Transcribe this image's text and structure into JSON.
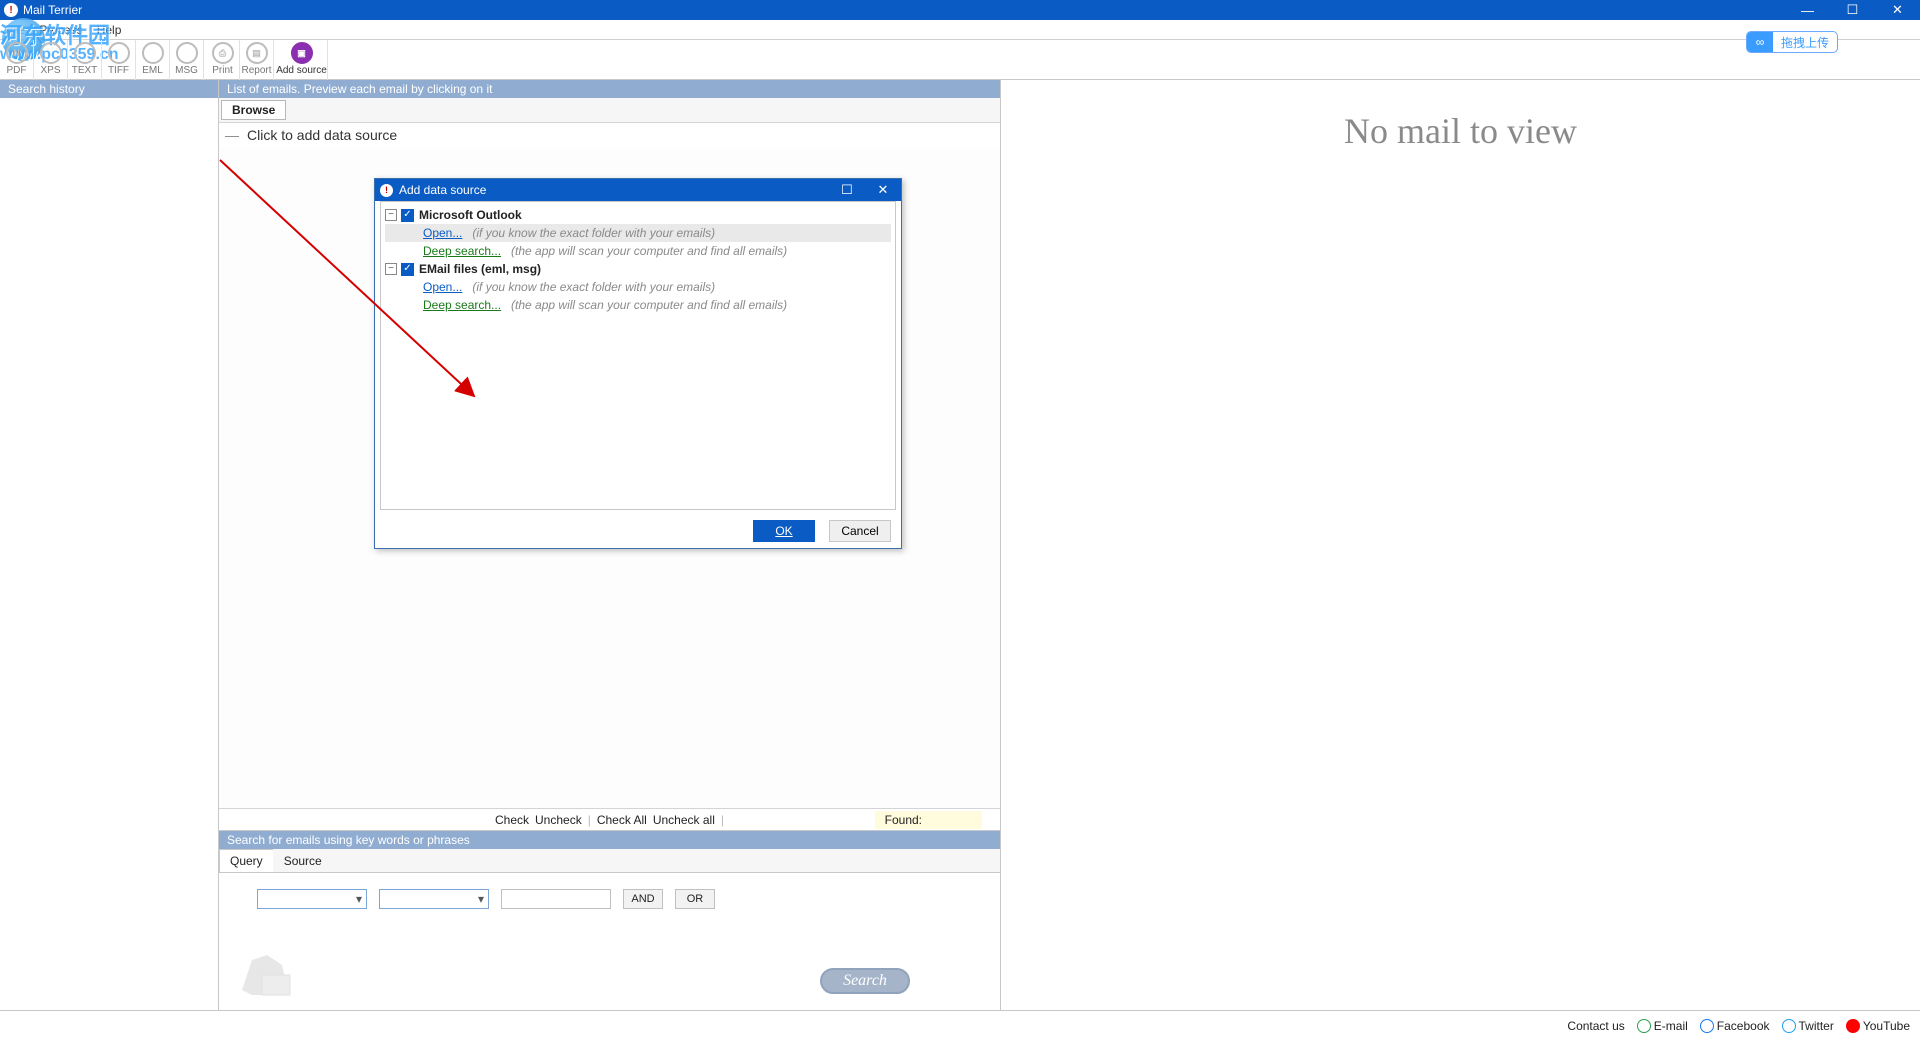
{
  "title": "Mail Terrier",
  "menu": {
    "file": "File",
    "process": "Process",
    "help": "Help"
  },
  "watermark": {
    "text": "河东软件园",
    "url": "www.pc0359.cn"
  },
  "upload_badge": "拖拽上传",
  "toolbar": [
    {
      "label": "PDF",
      "icon": "N"
    },
    {
      "label": "XPS",
      "icon": "○"
    },
    {
      "label": "TEXT",
      "icon": "○"
    },
    {
      "label": "TIFF",
      "icon": "○"
    },
    {
      "label": "EML",
      "icon": "○"
    },
    {
      "label": "MSG",
      "icon": "○"
    },
    {
      "label": "Print",
      "icon": "⎙"
    },
    {
      "label": "Report",
      "icon": "▤"
    },
    {
      "label": "Add source",
      "icon": "■",
      "active": true
    }
  ],
  "sidebar_header": "Search history",
  "list_header": "List of emails. Preview each email by clicking on it",
  "browse": "Browse",
  "add_source_row": "Click to add data source",
  "checks": {
    "check": "Check",
    "uncheck": "Uncheck",
    "checkall": "Check All",
    "uncheckall": "Uncheck all",
    "found": "Found:"
  },
  "preview_empty": "No mail to view",
  "search_header": "Search for emails using key words or phrases",
  "tabs": {
    "query": "Query",
    "source": "Source"
  },
  "ops": {
    "and": "AND",
    "or": "OR"
  },
  "search_btn": "Search",
  "footer": {
    "contact": "Contact us",
    "email": "E-mail",
    "facebook": "Facebook",
    "twitter": "Twitter",
    "youtube": "YouTube"
  },
  "dialog": {
    "title": "Add data source",
    "sources": [
      {
        "name": "Microsoft Outlook",
        "open": "Open...",
        "open_hint": "(if you know the exact folder with your emails)",
        "deep": "Deep search...",
        "deep_hint": "(the app will scan your computer and find all emails)"
      },
      {
        "name": "EMail files (eml, msg)",
        "open": "Open...",
        "open_hint": "(if you know the exact folder with your emails)",
        "deep": "Deep search...",
        "deep_hint": "(the app will scan your computer and find all emails)"
      }
    ],
    "ok": "OK",
    "cancel": "Cancel"
  }
}
